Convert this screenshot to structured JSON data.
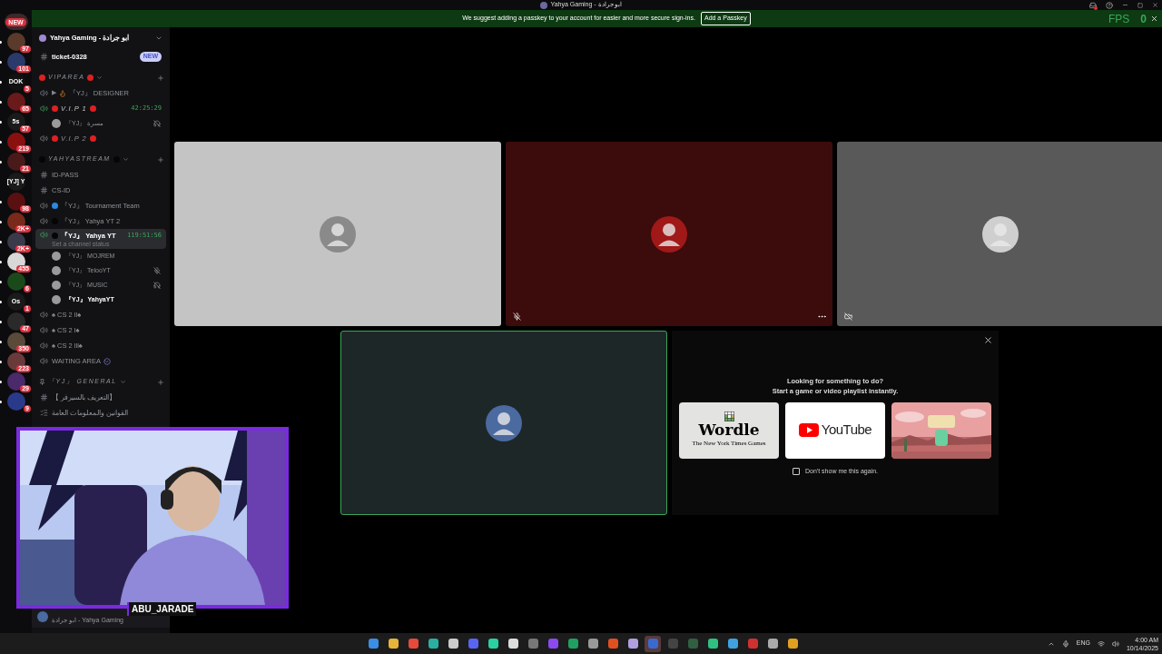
{
  "window": {
    "title": "Yahya Gaming - ابو جرادة",
    "inbox_alert": true
  },
  "banner": {
    "text": "We suggest adding a passkey to your account for easier and more secure sign-ins.",
    "button": "Add a Passkey",
    "fps_label": "FPS",
    "fps_value": "0"
  },
  "servers": [
    {
      "kind": "pill",
      "badge": "NEW",
      "color": "#3a2a2a",
      "unread": false
    },
    {
      "kind": "icon",
      "badge": "97",
      "color": "#5a3a2a",
      "unread": true
    },
    {
      "kind": "icon",
      "badge": "101",
      "color": "#2a3a6a",
      "unread": true
    },
    {
      "kind": "label",
      "label": "DOK",
      "badge": "5",
      "color": "#111111",
      "unread": true
    },
    {
      "kind": "icon",
      "badge": "65",
      "color": "#6a1a1a",
      "unread": true
    },
    {
      "kind": "label",
      "label": "5s",
      "badge": "57",
      "color": "#1a1a1a",
      "unread": true
    },
    {
      "kind": "icon",
      "badge": "219",
      "color": "#8a1010",
      "unread": true
    },
    {
      "kind": "icon",
      "badge": "21",
      "color": "#4a1a1a",
      "unread": true
    },
    {
      "kind": "label",
      "label": "[YJ] Y",
      "color": "#1a1a1a",
      "unread": false
    },
    {
      "kind": "icon",
      "badge": "98",
      "color": "#5a1010",
      "unread": true
    },
    {
      "kind": "icon",
      "badge": "2K+",
      "color": "#7a2a1a",
      "unread": true
    },
    {
      "kind": "icon",
      "badge": "2K+",
      "color": "#3a3a4a",
      "unread": true
    },
    {
      "kind": "icon",
      "badge": "455",
      "color": "#d8d8d8",
      "unread": true
    },
    {
      "kind": "icon",
      "badge": "6",
      "color": "#1a4a1a",
      "unread": true
    },
    {
      "kind": "label",
      "label": "Os",
      "badge": "1",
      "color": "#1a1a1a",
      "unread": true
    },
    {
      "kind": "icon",
      "badge": "47",
      "color": "#2a2a2a",
      "unread": true
    },
    {
      "kind": "icon",
      "badge": "350",
      "color": "#5a4a3a",
      "unread": true
    },
    {
      "kind": "icon",
      "badge": "223",
      "color": "#6a3a3a",
      "unread": true
    },
    {
      "kind": "icon",
      "badge": "29",
      "color": "#4a2a6a",
      "unread": true
    },
    {
      "kind": "icon",
      "badge": "9",
      "color": "#2a3a8a",
      "unread": true
    }
  ],
  "sidebar": {
    "server_name": "Yahya Gaming - ابو جرادة",
    "channels": [
      {
        "kind": "text",
        "name": "ticket-0328",
        "badge": "NEW",
        "unread": true
      },
      {
        "kind": "category",
        "name": "VIPAREA",
        "color": "#e02020"
      },
      {
        "kind": "voice",
        "prefix": "▶",
        "name": "『YJ』 DESIGNER",
        "flame": true,
        "active": false,
        "selected": false
      },
      {
        "kind": "voice",
        "name": "V.I.P 1",
        "color": "#e02020",
        "active": true,
        "selected": false,
        "time": "42:25:29",
        "children": [
          {
            "name": "『YJ』 مسرة",
            "muted": false,
            "deafened": true,
            "bold": false
          }
        ]
      },
      {
        "kind": "voice",
        "name": "V.I.P 2",
        "color": "#e02020",
        "active": false,
        "selected": false
      },
      {
        "kind": "category",
        "name": "YAHYASTREAM",
        "color": "#050505"
      },
      {
        "kind": "text",
        "name": "ID-PASS",
        "unread": false
      },
      {
        "kind": "text",
        "name": "CS-ID",
        "unread": false
      },
      {
        "kind": "voice",
        "name": "『YJ』 Tournament Team",
        "color": "#2a8ae0",
        "active": false,
        "selected": false
      },
      {
        "kind": "voice",
        "name": "『YJ』 Yahya YT 2",
        "color": "#050505",
        "active": false,
        "selected": false
      },
      {
        "kind": "voice",
        "name": "『YJ』 Yahya YT",
        "color": "#050505",
        "active": true,
        "selected": true,
        "time": "119:51:56",
        "status": "Set a channel status",
        "children": [
          {
            "name": "『YJ』 MOJREM",
            "muted": false,
            "deafened": false,
            "bold": false
          },
          {
            "name": "『YJ』 TelooYT",
            "muted": true,
            "deafened": false,
            "bold": false
          },
          {
            "name": "『YJ』 MUSIC",
            "muted": false,
            "deafened": true,
            "bold": false
          },
          {
            "name": "『YJ』 YahyaYT",
            "muted": false,
            "deafened": false,
            "bold": true
          }
        ]
      },
      {
        "kind": "voice",
        "name": "♠ CS 2 ll♠",
        "active": false,
        "selected": false
      },
      {
        "kind": "voice",
        "name": "♠ CS 2 l♠",
        "active": false,
        "selected": false
      },
      {
        "kind": "voice",
        "name": "♠ CS 2 lll♠",
        "active": false,
        "selected": false
      },
      {
        "kind": "voice",
        "name": "WAITING AREA",
        "verified": true,
        "active": false,
        "selected": false
      },
      {
        "kind": "category",
        "name": "『YJ』 GENERAL",
        "pin": true
      },
      {
        "kind": "text",
        "name": "【 التعريف بالسيرفر】",
        "unread": false
      },
      {
        "kind": "rules",
        "name": "القوانين والمعلومات العامة",
        "unread": false
      }
    ],
    "user_subtitle": "ابو جرادة - Yahya Gaming"
  },
  "tiles": [
    {
      "color": "#c4c4c4",
      "avatar": {
        "color": "#8a8a8a"
      },
      "muted": false,
      "camera_off": false,
      "menu": false,
      "speaking": false
    },
    {
      "color": "#3c0b0b",
      "avatar": {
        "color": "#a01818"
      },
      "muted": true,
      "camera_off": false,
      "menu": true,
      "speaking": false
    },
    {
      "color": "#595959",
      "avatar": {
        "color": "#cfcfcf"
      },
      "muted": false,
      "camera_off": true,
      "menu": false,
      "speaking": false
    },
    {
      "color": "#1e2727",
      "avatar": {
        "color": "#4a6aa0"
      },
      "muted": false,
      "camera_off": false,
      "menu": false,
      "speaking": true
    }
  ],
  "activity": {
    "title": "Looking for something to do?",
    "subtitle": "Start a game or video playlist instantly.",
    "cards": [
      {
        "kind": "wordle",
        "name": "Wordle",
        "byline": "The New York Times Games"
      },
      {
        "kind": "youtube",
        "name": "YouTube"
      },
      {
        "kind": "picture"
      }
    ],
    "checkbox": {
      "label": "Don't show me this again.",
      "checked": false
    }
  },
  "webcam": {
    "label": "ABU_JARADE"
  },
  "taskbar": {
    "apps": [
      {
        "color": "#3a8ee6",
        "selected": false
      },
      {
        "color": "#e6b43a",
        "selected": false
      },
      {
        "color": "#e64a3a",
        "selected": false
      },
      {
        "color": "#2ab0a0",
        "selected": false
      },
      {
        "color": "#cccccc",
        "selected": false
      },
      {
        "color": "#5865f2",
        "selected": false
      },
      {
        "color": "#2ad0a0",
        "selected": false
      },
      {
        "color": "#dddddd",
        "selected": false
      },
      {
        "color": "#777777",
        "selected": false
      },
      {
        "color": "#8a4af0",
        "selected": false
      },
      {
        "color": "#20a060",
        "selected": false
      },
      {
        "color": "#999999",
        "selected": false
      },
      {
        "color": "#e05020",
        "selected": false
      },
      {
        "color": "#b0a0e0",
        "selected": false
      },
      {
        "color": "#3a6ad0",
        "selected": true
      },
      {
        "color": "#444444",
        "selected": false
      },
      {
        "color": "#306040",
        "selected": false
      },
      {
        "color": "#30c080",
        "selected": false
      },
      {
        "color": "#40a0e0",
        "selected": false
      },
      {
        "color": "#d03030",
        "selected": false
      },
      {
        "color": "#aaaaaa",
        "selected": false
      },
      {
        "color": "#e0a020",
        "selected": false
      }
    ],
    "language": "ENG",
    "time": "4:00 AM",
    "date": "10/14/2025"
  }
}
